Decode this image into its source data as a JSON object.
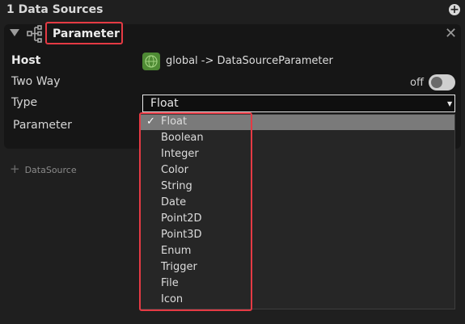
{
  "header": {
    "title": "1 Data Sources",
    "add_icon": "plus-circle-icon"
  },
  "panel": {
    "title": "Parameter",
    "host_label": "Host",
    "host_value": "global -> DataSourceParameter",
    "two_way_label": "Two Way",
    "two_way_state": "off",
    "type_label": "Type",
    "type_value": "Float",
    "parameter_label": "Parameter"
  },
  "add_datasource": {
    "label": "DataSource"
  },
  "dropdown": {
    "check_glyph": "✓",
    "options": [
      "Float",
      "Boolean",
      "Integer",
      "Color",
      "String",
      "Date",
      "Point2D",
      "Point3D",
      "Enum",
      "Trigger",
      "File",
      "Icon"
    ],
    "selected": "Float"
  },
  "colors": {
    "highlight_red": "#e53a44",
    "globe_green": "#4e8a34"
  }
}
